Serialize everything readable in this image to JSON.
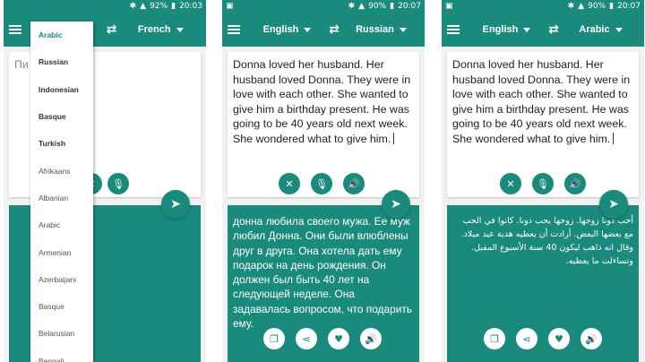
{
  "phones": [
    {
      "status": {
        "battery": "92%",
        "time": "20:03"
      },
      "from_lang": "",
      "to_lang": "French",
      "input_text": "Пи",
      "dropdown": [
        {
          "label": "Arabic",
          "style": "selected"
        },
        {
          "label": "Russian",
          "style": "bold"
        },
        {
          "label": "Indonesian",
          "style": "bold"
        },
        {
          "label": "Basque",
          "style": "bold"
        },
        {
          "label": "Turkish",
          "style": "bold"
        },
        {
          "label": "Afrikaans",
          "style": "normal"
        },
        {
          "label": "Albanian",
          "style": "normal"
        },
        {
          "label": "Arabic",
          "style": "normal"
        },
        {
          "label": "Armenian",
          "style": "normal"
        },
        {
          "label": "Azerbaijani",
          "style": "normal"
        },
        {
          "label": "Basque",
          "style": "normal"
        },
        {
          "label": "Belarusian",
          "style": "normal"
        },
        {
          "label": "Bengali",
          "style": "normal"
        }
      ]
    },
    {
      "status": {
        "battery": "90%",
        "time": "20:07"
      },
      "from_lang": "English",
      "to_lang": "Russian",
      "input_text": "Donna loved her husband. Her husband loved Donna. They were in love with each other. She wanted to give him a birthday present. He was going to be 40 years old next week. She wondered what to give him.",
      "output_text": "донна любила своего мужа. Ее муж любил Донна. Они были влюблены друг в друга. Она хотела дать ему подарок на день рождения. Он должен был быть 40 лет на следующей неделе. Она задавалась вопросом, что подарить ему."
    },
    {
      "status": {
        "battery": "90%",
        "time": "20:07"
      },
      "from_lang": "English",
      "to_lang": "Arabic",
      "input_text": "Donna loved her husband. Her husband loved Donna. They were in love with each other. She wanted to give him a birthday present. He was going to be 40 years old next week. She wondered what to give him.",
      "output_text": "أحب دونا زوجها. زوجها يحب دونا. كانوا في الحب مع بعضها البعض. أرادت أن يعطيه هدية عيد ميلاد. وقال انه ذاهب ليكون 40 سنة الأسبوع المقبل. وتساءلت ما يعطيه."
    }
  ],
  "icons": {
    "menu": "menu-icon",
    "swap": "swap-icon",
    "clear": "close-icon",
    "mic": "mic-icon",
    "speaker": "speaker-icon",
    "send": "send-icon",
    "copy": "copy-icon",
    "share": "share-icon",
    "favorite": "heart-icon"
  },
  "colors": {
    "accent": "#1a8a7c",
    "background": "#f2f2f2"
  }
}
